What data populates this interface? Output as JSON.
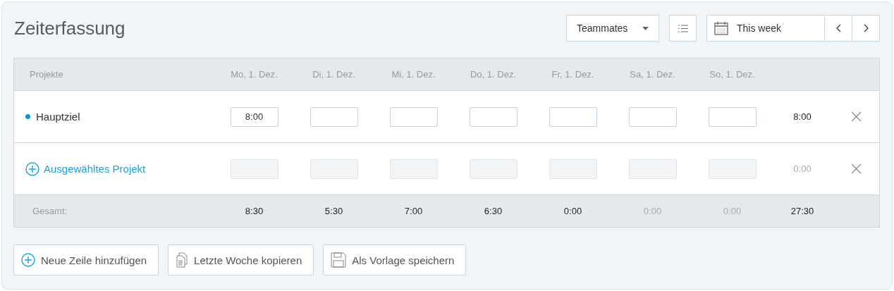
{
  "title": "Zeiterfassung",
  "toolbar": {
    "filter": {
      "label": "Teammates"
    },
    "date": {
      "label": "This week"
    }
  },
  "table": {
    "columns": [
      "Projekte",
      "Mo, 1. Dez.",
      "Di, 1. Dez.",
      "Mi, 1. Dez.",
      "Do, 1. Dez.",
      "Fr, 1. Dez.",
      "Sa, 1. Dez.",
      "So, 1. Dez."
    ],
    "rows": [
      {
        "kind": "project",
        "name": "Hauptziel",
        "color": "#1a8fd6",
        "entries": [
          {
            "value": "8:00",
            "disabled": false
          },
          {
            "disabled": false
          },
          {
            "disabled": false
          },
          {
            "disabled": false
          },
          {
            "disabled": false
          },
          {
            "disabled": false
          },
          {
            "disabled": false
          }
        ],
        "total": {
          "value": "8:00",
          "muted": false
        }
      },
      {
        "kind": "picker",
        "name": "Ausgewähltes Projekt",
        "entries": [
          {
            "disabled": true
          },
          {
            "disabled": true
          },
          {
            "disabled": true
          },
          {
            "disabled": true
          },
          {
            "disabled": true
          },
          {
            "disabled": true
          },
          {
            "disabled": true
          }
        ],
        "total": {
          "value": "0:00",
          "muted": true
        }
      }
    ],
    "footer": {
      "label": "Gesamt:",
      "totals": [
        {
          "value": "8:30",
          "muted": false
        },
        {
          "value": "5:30",
          "muted": false
        },
        {
          "value": "7:00",
          "muted": false
        },
        {
          "value": "6:30",
          "muted": false
        },
        {
          "value": "0:00",
          "muted": false
        },
        {
          "value": "0:00",
          "muted": true
        },
        {
          "value": "0:00",
          "muted": true
        },
        {
          "value": "27:30",
          "muted": false
        }
      ]
    }
  },
  "actions": [
    {
      "kind": "add",
      "label": "Neue Zeile hinzufügen"
    },
    {
      "kind": "copy",
      "label": "Letzte Woche kopieren"
    },
    {
      "kind": "save",
      "label": "Als Vorlage speichern"
    }
  ]
}
